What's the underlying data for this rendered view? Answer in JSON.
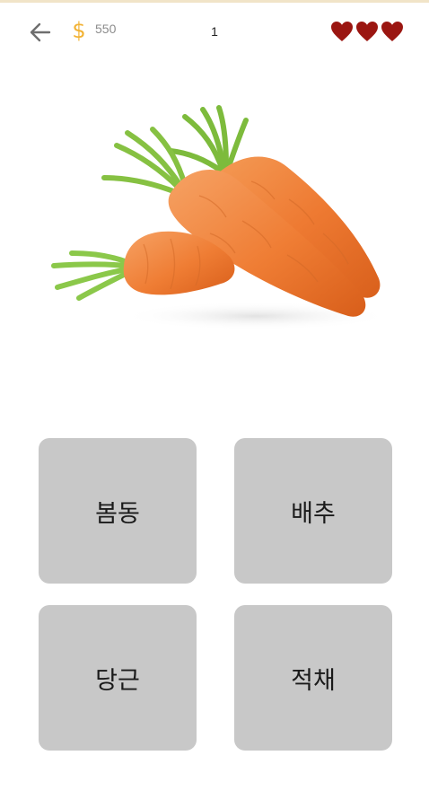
{
  "header": {
    "coins": "550",
    "level": "1",
    "hearts": 3,
    "colors": {
      "accent": "#f1e4c8",
      "coin": "#f2b233",
      "heart": "#9b1611",
      "back_arrow": "#6e6e6e"
    }
  },
  "question": {
    "image_icon": "carrot-image"
  },
  "answers": [
    {
      "label": "봄동"
    },
    {
      "label": "배추"
    },
    {
      "label": "당근"
    },
    {
      "label": "적채"
    }
  ],
  "colors": {
    "answer_bg": "#c8c8c8",
    "background": "#ffffff"
  }
}
